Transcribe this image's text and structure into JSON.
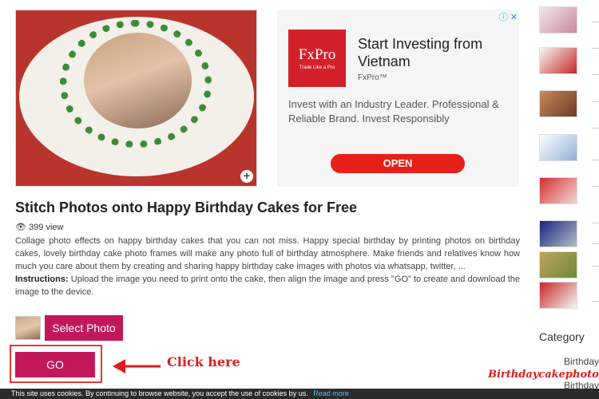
{
  "post": {
    "title": "Stitch Photos onto Happy Birthday Cakes for Free",
    "views": "399 view",
    "description": "Collage photo effects on happy birthday cakes that you can not miss. Happy special birthday by printing photos on birthday cakes, lovely birthday cake photo frames will make any photo full of birthday atmosphere. Make friends and relatives know how much you care about them by creating and sharing happy birthday cake images with photos via whatsapp, twitter, ...",
    "instructions_label": "Instructions:",
    "instructions_text": "Upload the image you need to print onto the cake, then align the image and press \"GO\" to create and download the image to the device."
  },
  "ad": {
    "logo_text": "FxPro",
    "logo_tagline": "Trade Like a Pro",
    "headline": "Start Investing from Vietnam",
    "brand": "FxPro™",
    "body": "Invest with an Industry Leader. Professional & Reliable Brand. Invest Responsibly",
    "cta": "OPEN",
    "icons": "ⓘ ✕"
  },
  "actions": {
    "select_photo": "Select Photo",
    "go": "GO",
    "hint": "Click here"
  },
  "sidebar": {
    "category_title": "Category",
    "category_items": [
      "Birthday",
      "Birthday"
    ]
  },
  "watermark": "Birthdaycakephoto.net",
  "cookie": {
    "text": "This site uses cookies. By continuing to browse website, you accept the use of cookies by us.",
    "link": "Read more"
  },
  "colors": {
    "accent": "#c2185b",
    "ad_cta": "#e8201a",
    "ad_logo": "#d4202a",
    "highlight": "#e53935"
  }
}
